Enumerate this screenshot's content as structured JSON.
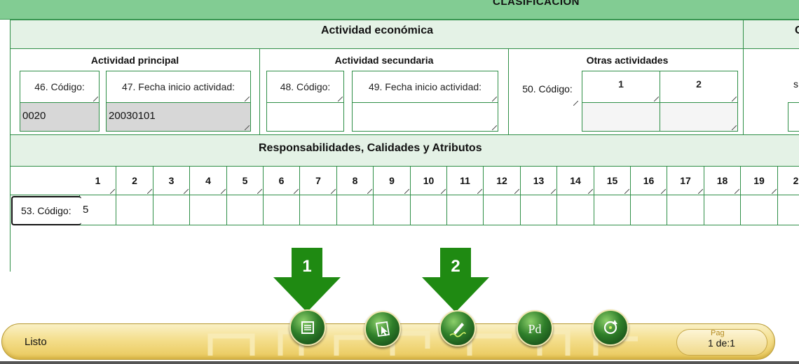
{
  "header": {
    "title": "CLASIFICACIÓN"
  },
  "sections": {
    "economic_activity": "Actividad económica",
    "right_cut_label": "C",
    "responsibilities": "Responsabilidades, Calidades y Atributos"
  },
  "activity": {
    "principal": {
      "title": "Actividad principal",
      "code_label": "46. Código:",
      "code_value": "0020",
      "date_label": "47. Fecha inicio actividad:",
      "date_value": "20030101"
    },
    "secondary": {
      "title": "Actividad secundaria",
      "code_label": "48. Código:",
      "code_value": "",
      "date_label": "49. Fecha inicio actividad:",
      "date_value": ""
    },
    "other": {
      "title": "Otras actividades",
      "code_label": "50. Código:",
      "col1": "1",
      "col2": "2"
    },
    "cut_letter": "s"
  },
  "responsibilities_table": {
    "columns": [
      "1",
      "2",
      "3",
      "4",
      "5",
      "6",
      "7",
      "8",
      "9",
      "10",
      "11",
      "12",
      "13",
      "14",
      "15",
      "16",
      "17",
      "18",
      "19",
      "2"
    ],
    "row_label": "53. Código:",
    "values": [
      "5",
      "",
      "",
      "",
      "",
      "",
      "",
      "",
      "",
      "",
      "",
      "",
      "",
      "",
      "",
      "",
      "",
      "",
      "",
      ""
    ]
  },
  "annotations": {
    "arrow1": "1",
    "arrow2": "2"
  },
  "toolbar": {
    "buttons": [
      "form-icon",
      "cursor-map-icon",
      "signature-icon",
      "pdf-icon",
      "refresh-icon"
    ]
  },
  "status": {
    "text": "Listo",
    "page_label": "Pag",
    "page_value": "1 de:1"
  },
  "colors": {
    "banner": "#82cc93",
    "band": "#e4f2e6",
    "border": "#2f8f47",
    "arrow": "#1f8a12",
    "statusbar": "#f4de8c"
  }
}
